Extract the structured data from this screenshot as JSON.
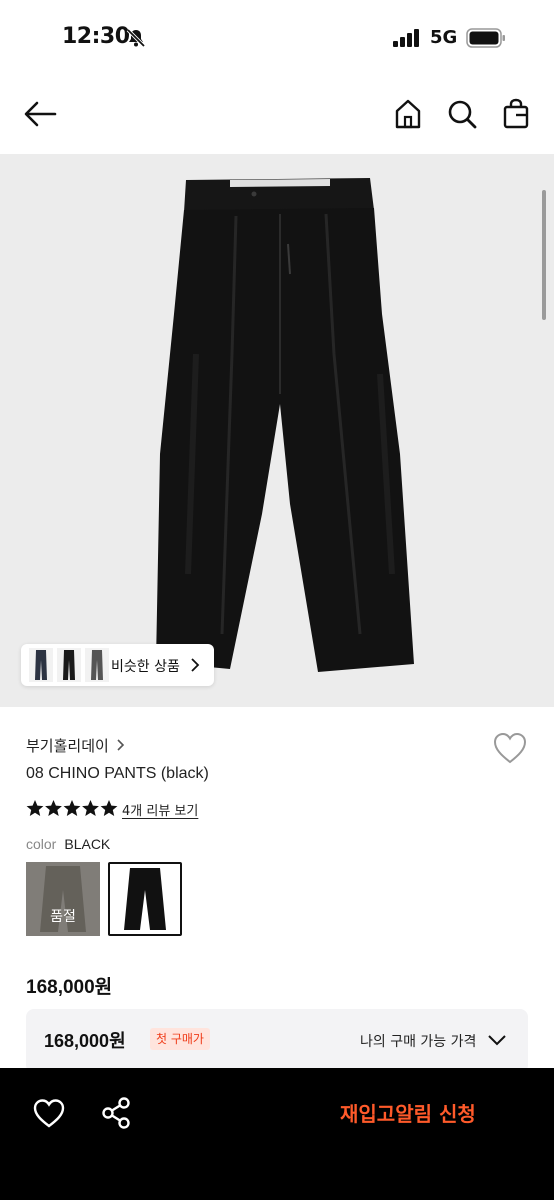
{
  "status_bar": {
    "time": "12:30",
    "network": "5G"
  },
  "similar": {
    "label": "비슷한 상품"
  },
  "product": {
    "brand": "부기홀리데이",
    "name": "08 CHINO PANTS (black)",
    "rating": 5,
    "review_link": "4개 리뷰 보기",
    "color_label": "color",
    "color_value": "BLACK",
    "swatches": [
      {
        "name": "khaki",
        "status": "품절"
      },
      {
        "name": "black",
        "selected": true
      }
    ],
    "price": "168,000원"
  },
  "my_price": {
    "value": "168,000원",
    "badge": "첫 구매가",
    "label": "나의 구매 가능 가격"
  },
  "bottom_bar": {
    "restock_label": "재입고알림 신청"
  },
  "colors": {
    "accent": "#ff5a2a",
    "badge_text": "#ef3b18",
    "badge_bg": "#ffe4dd",
    "image_bg": "#ececec"
  },
  "icons": [
    "bell-off-icon",
    "signal-icon",
    "battery-icon",
    "back-arrow-icon",
    "home-icon",
    "search-icon",
    "cart-icon",
    "heart-icon",
    "star-icon",
    "share-icon",
    "chevron-right-icon",
    "chevron-down-icon"
  ]
}
